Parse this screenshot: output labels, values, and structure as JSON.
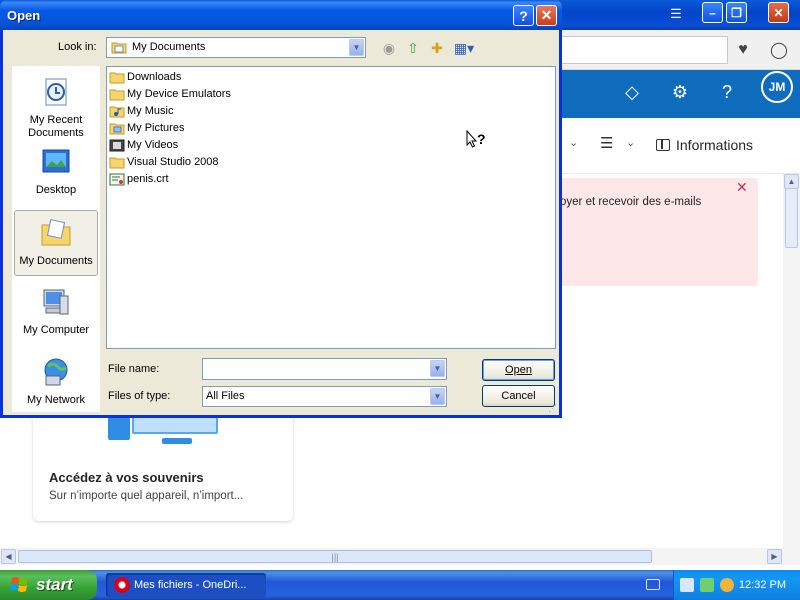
{
  "browser": {
    "banner_text": "oyer et recevoir des e-mails",
    "informations_label": "Informations",
    "avatar_initials": "JM",
    "card_title": "Accédez à vos souvenirs",
    "card_subtitle": "Sur n’importe quel appareil, n’import..."
  },
  "dialog": {
    "title": "Open",
    "help_glyph": "?",
    "close_glyph": "✕",
    "look_in_label": "Look in:",
    "look_in_value": "My Documents",
    "places": [
      {
        "label": "My Recent Documents",
        "icon": "recent-documents-icon"
      },
      {
        "label": "Desktop",
        "icon": "desktop-icon"
      },
      {
        "label": "My Documents",
        "icon": "my-documents-icon"
      },
      {
        "label": "My Computer",
        "icon": "my-computer-icon"
      },
      {
        "label": "My Network",
        "icon": "my-network-icon"
      }
    ],
    "files": [
      {
        "name": "Downloads",
        "icon": "folder-icon"
      },
      {
        "name": "My Device Emulators",
        "icon": "folder-icon"
      },
      {
        "name": "My Music",
        "icon": "music-folder-icon"
      },
      {
        "name": "My Pictures",
        "icon": "pictures-folder-icon"
      },
      {
        "name": "My Videos",
        "icon": "videos-folder-icon"
      },
      {
        "name": "Visual Studio 2008",
        "icon": "folder-icon"
      },
      {
        "name": "penis.crt",
        "icon": "certificate-file-icon"
      }
    ],
    "file_name_label": "File name:",
    "file_name_value": "",
    "files_of_type_label": "Files of type:",
    "files_of_type_value": "All Files",
    "open_button": "Open",
    "cancel_button": "Cancel"
  },
  "taskbar": {
    "start_label": "start",
    "task_label": "Mes fichiers - OneDri...",
    "clock": "12:32 PM"
  },
  "colors": {
    "xp_blue": "#0831d9",
    "dialog_face": "#ece9d8",
    "outlook_blue": "#0f6cbd",
    "banner_pink": "#fde7e9"
  }
}
